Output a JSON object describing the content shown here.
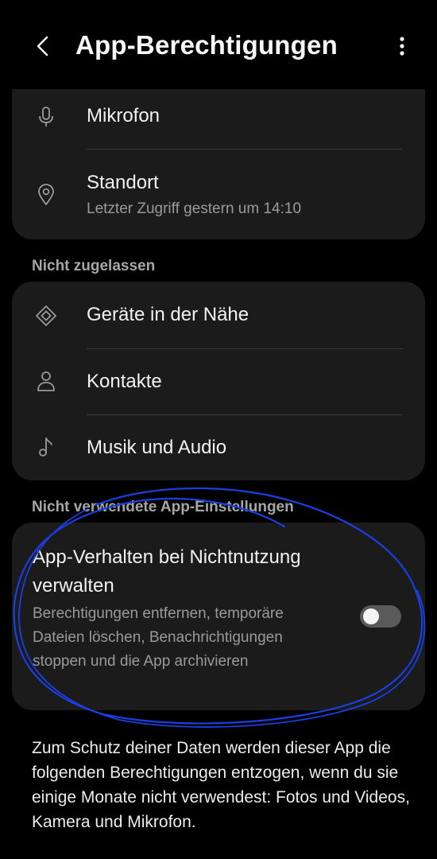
{
  "header": {
    "title": "App-Berechtigungen",
    "back_icon": "chevron-left-icon",
    "more_icon": "more-vertical-icon"
  },
  "allowed_items": [
    {
      "label": "Mikrofon",
      "icon": "microphone-icon"
    },
    {
      "label": "Standort",
      "subtitle": "Letzter Zugriff gestern um 14:10",
      "icon": "location-pin-icon"
    }
  ],
  "denied_section": {
    "header": "Nicht zugelassen",
    "items": [
      {
        "label": "Geräte in der Nähe",
        "icon": "nearby-devices-icon"
      },
      {
        "label": "Kontakte",
        "icon": "person-icon"
      },
      {
        "label": "Musik und Audio",
        "icon": "music-note-icon"
      }
    ]
  },
  "unused_section": {
    "header": "Nicht verwendete App-Einstellungen",
    "title": "App-Verhalten bei Nichtnutzung verwalten",
    "description": "Berechtigungen entfernen, temporäre Dateien löschen, Benachrichtigungen stoppen und die App archivieren",
    "toggle_on": false
  },
  "footer_text": "Zum Schutz deiner Daten werden dieser App die folgenden Berechtigungen entzogen, wenn du sie einige Monate nicht verwendest: Fotos und Videos, Kamera und Mikrofon.",
  "colors": {
    "background": "#000000",
    "card": "#1b1b1b",
    "annotation": "#1a3fe0"
  }
}
